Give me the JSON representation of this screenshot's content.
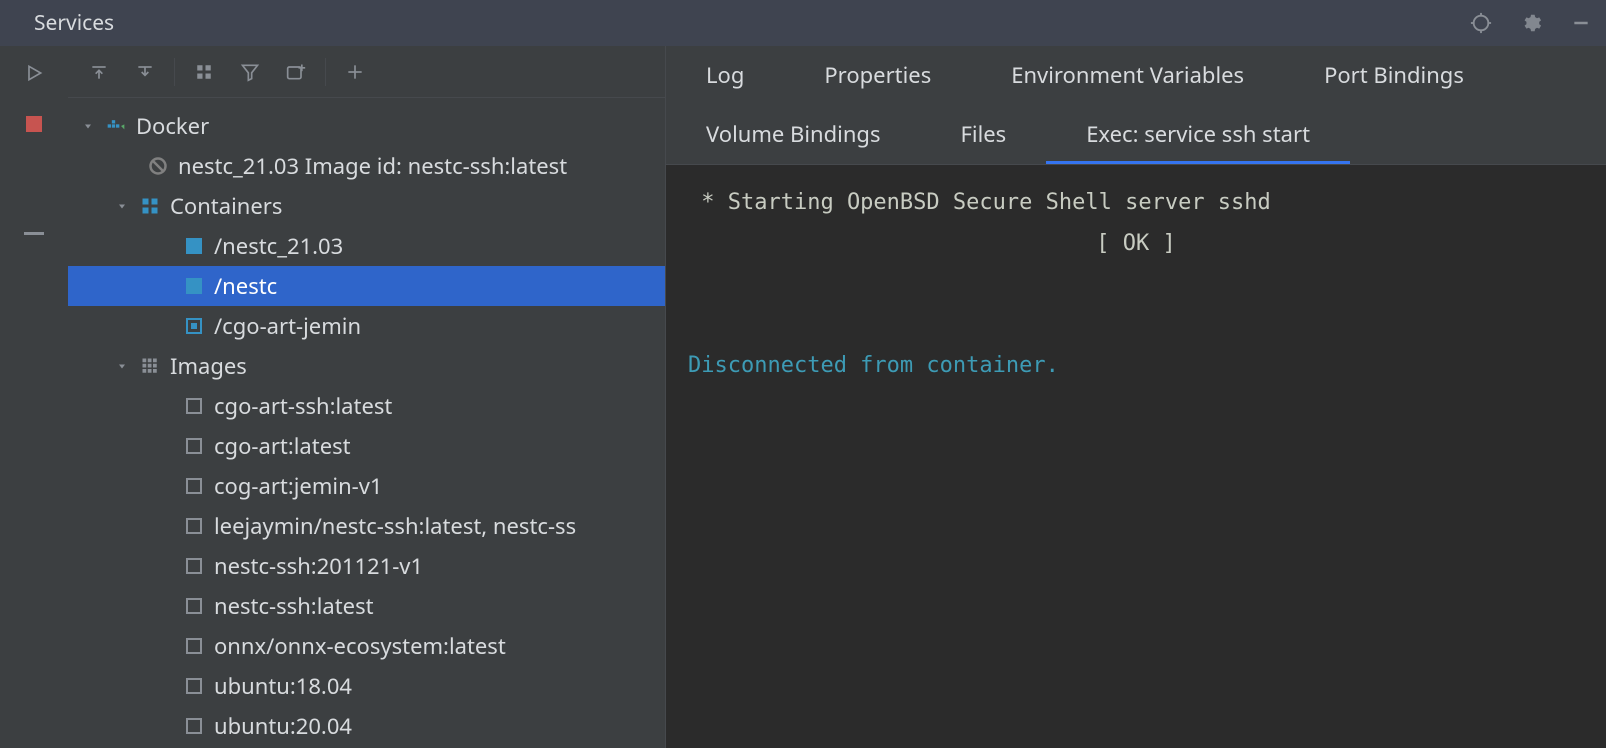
{
  "titlebar": {
    "title": "Services"
  },
  "tree": {
    "root_label": "Docker",
    "line2_label": "nestc_21.03 Image id: nestc-ssh:latest",
    "containers_label": "Containers",
    "containers": [
      {
        "label": "/nestc_21.03",
        "state": "running"
      },
      {
        "label": "/nestc",
        "state": "running"
      },
      {
        "label": "/cgo-art-jemin",
        "state": "stopped"
      }
    ],
    "images_label": "Images",
    "images": [
      "cgo-art-ssh:latest",
      "cgo-art:latest",
      "cog-art:jemin-v1",
      "leejaymin/nestc-ssh:latest, nestc-ss",
      "nestc-ssh:201121-v1",
      "nestc-ssh:latest",
      "onnx/onnx-ecosystem:latest",
      "ubuntu:18.04",
      "ubuntu:20.04"
    ]
  },
  "tabs": {
    "row1": [
      "Log",
      "Properties",
      "Environment Variables",
      "Port Bindings"
    ],
    "row2": [
      "Volume Bindings",
      "Files",
      "Exec: service ssh start"
    ],
    "active": "Exec: service ssh start"
  },
  "terminal": {
    "line1": " * Starting OpenBSD Secure Shell server sshd",
    "ok": "[ OK ]",
    "disc": "Disconnected from container."
  }
}
